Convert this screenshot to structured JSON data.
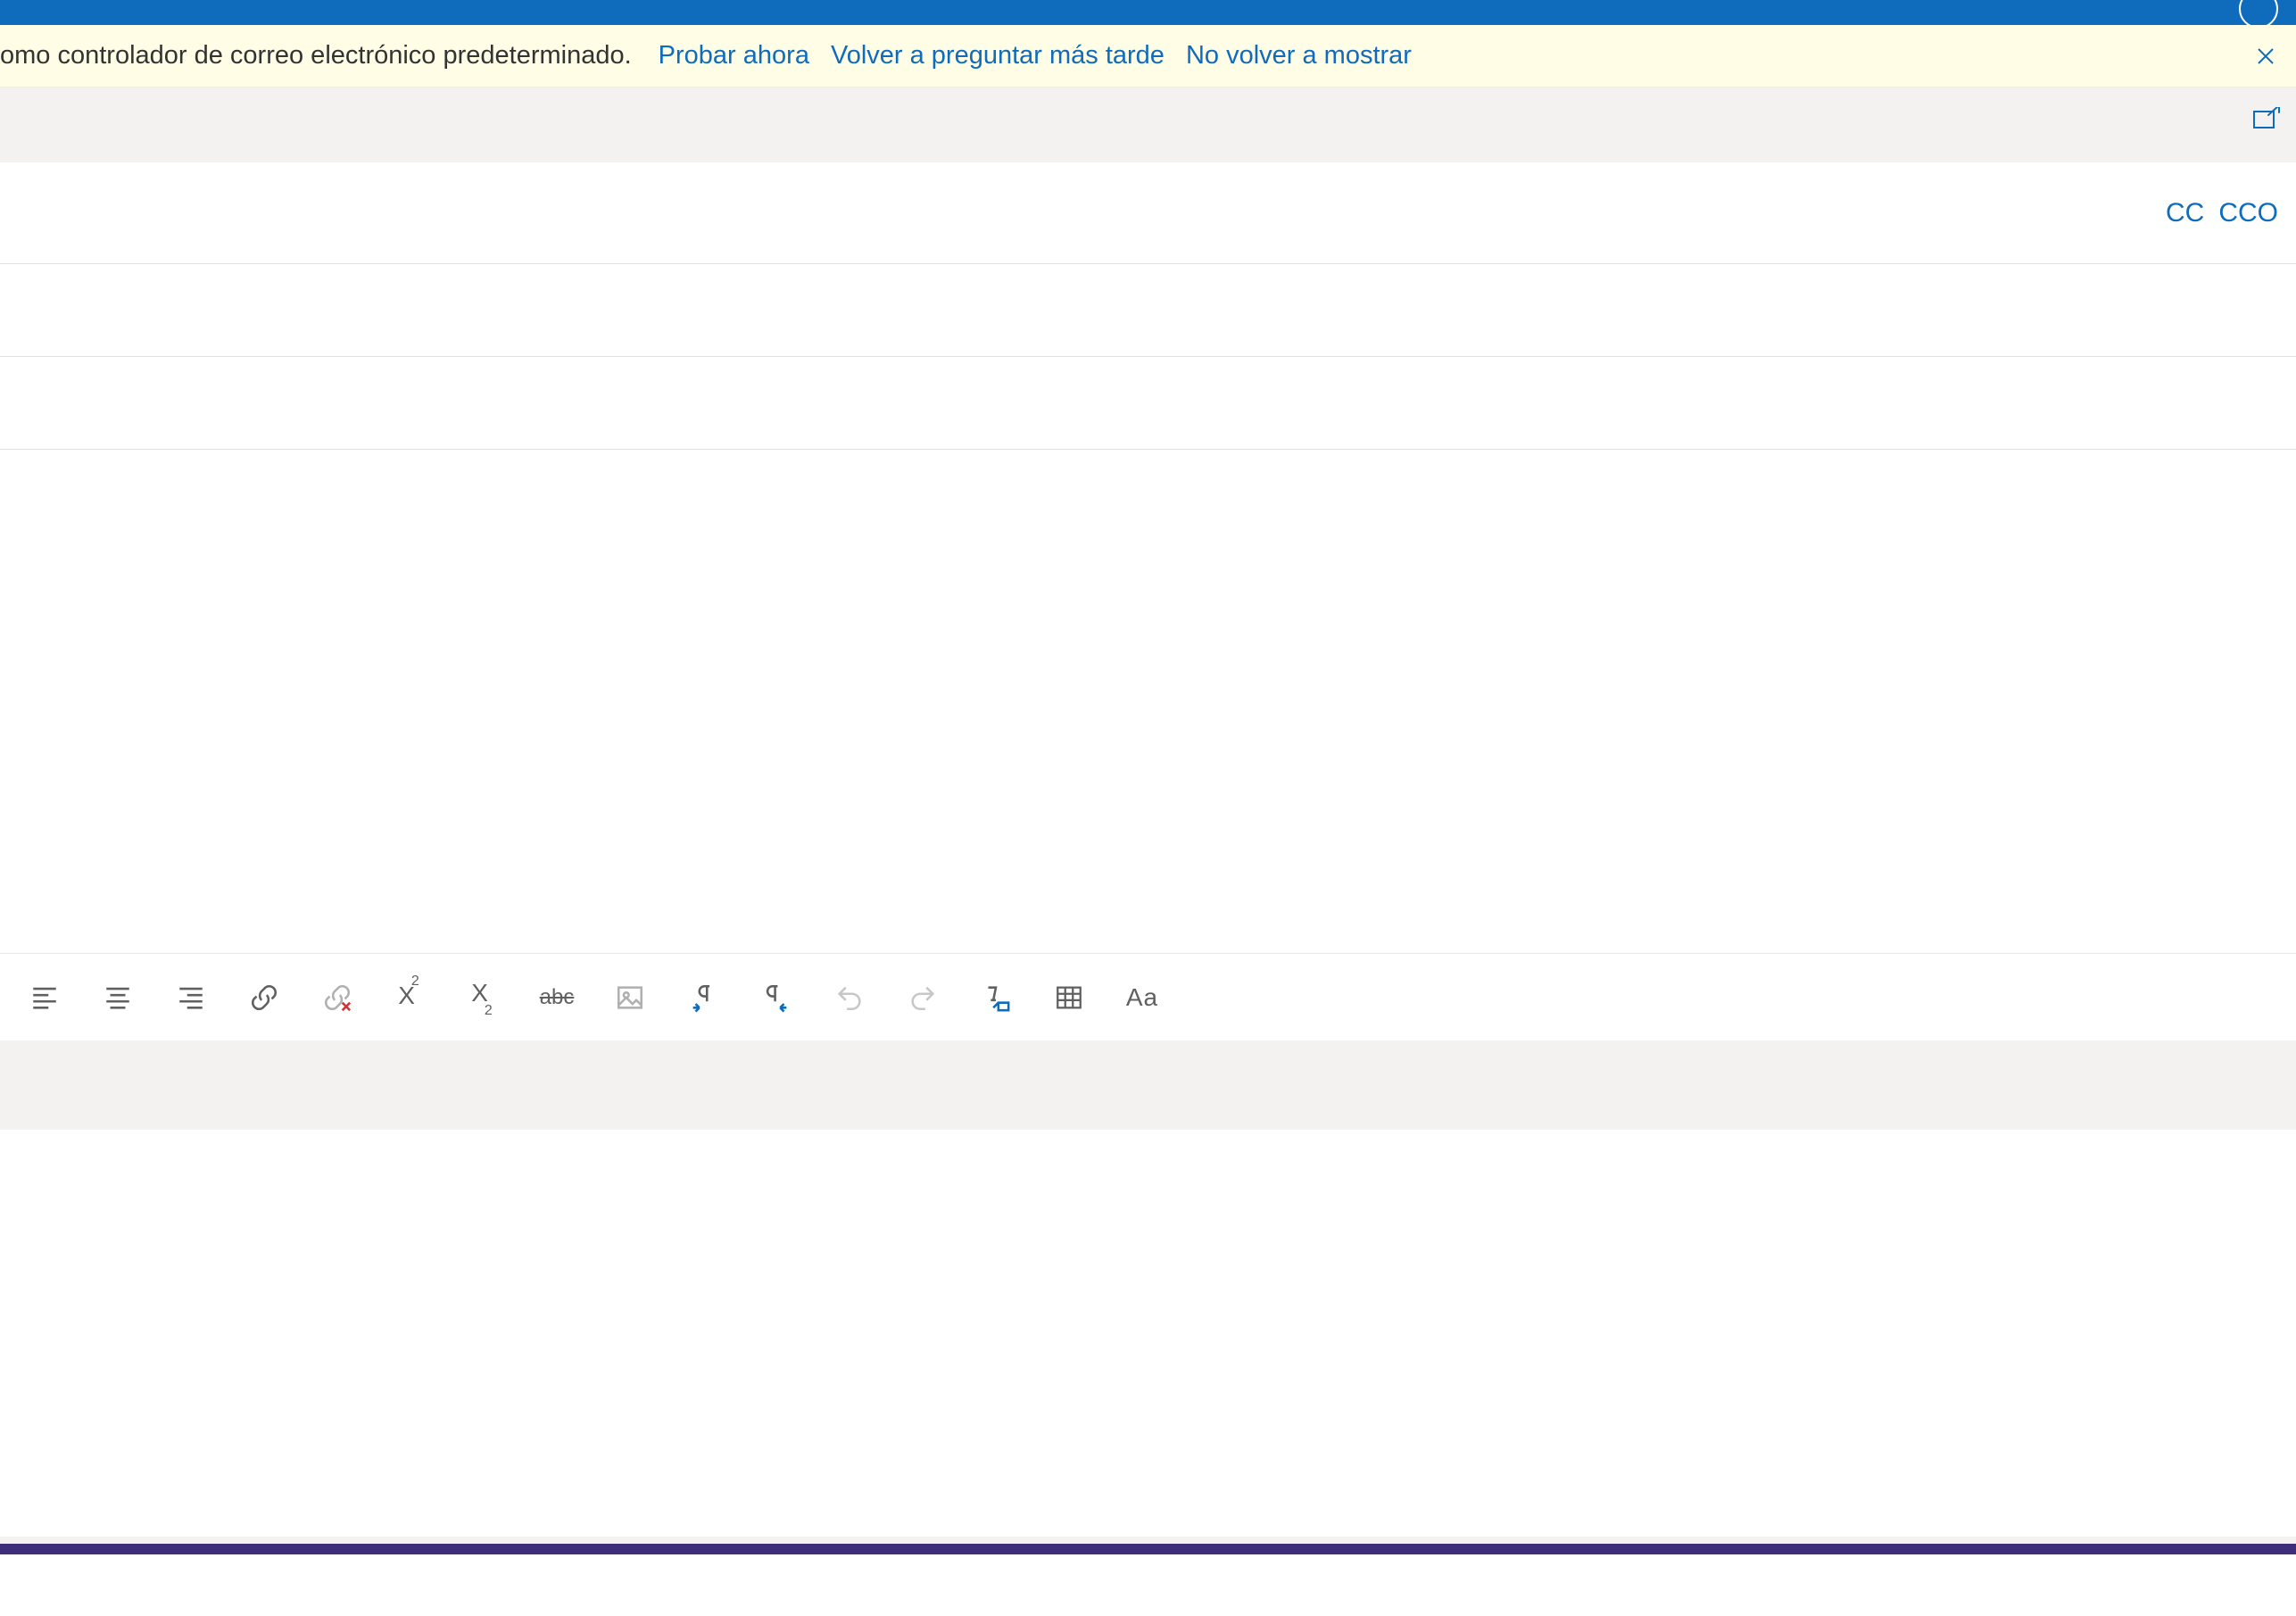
{
  "notification": {
    "message": "omo controlador de correo electrónico predeterminado.",
    "try_now": "Probar ahora",
    "ask_later": "Volver a preguntar más tarde",
    "dont_show": "No volver a mostrar"
  },
  "compose": {
    "cc_label": "CC",
    "cco_label": "CCO",
    "to_value": "",
    "cc_value": "",
    "subject_value": "",
    "body_value": ""
  },
  "toolbar": {
    "align_left": "align-left",
    "align_center": "align-center",
    "align_right": "align-right",
    "link": "link",
    "unlink": "unlink",
    "superscript": "X",
    "superscript_sup": "2",
    "subscript": "X",
    "subscript_sub": "2",
    "strikethrough": "abc",
    "image": "image",
    "ltr": "ltr",
    "rtl": "rtl",
    "undo": "undo",
    "redo": "redo",
    "clear_format": "clear-format",
    "table": "table",
    "case": "Aa"
  }
}
